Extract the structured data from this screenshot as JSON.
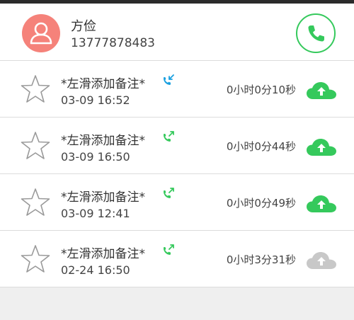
{
  "contact": {
    "name": "方俭",
    "phone": "13777878483",
    "avatar_icon": "person-icon",
    "call_icon": "phone-icon"
  },
  "colors": {
    "avatar_bg": "#f5827a",
    "accent_green": "#35c95c",
    "incoming_blue": "#1aa0e0",
    "cloud_gray": "#c8c8c8"
  },
  "calls": [
    {
      "note": "*左滑添加备注*",
      "date": "03-09 16:52",
      "duration": "0小时0分10秒",
      "direction": "incoming",
      "direction_icon": "incoming-call-icon",
      "uploaded": true,
      "cloud_icon": "cloud-upload-icon"
    },
    {
      "note": "*左滑添加备注*",
      "date": "03-09 16:50",
      "duration": "0小时0分44秒",
      "direction": "outgoing",
      "direction_icon": "outgoing-call-icon",
      "uploaded": true,
      "cloud_icon": "cloud-upload-icon"
    },
    {
      "note": "*左滑添加备注*",
      "date": "03-09 12:41",
      "duration": "0小时0分49秒",
      "direction": "outgoing",
      "direction_icon": "outgoing-call-icon",
      "uploaded": true,
      "cloud_icon": "cloud-upload-icon"
    },
    {
      "note": "*左滑添加备注*",
      "date": "02-24 16:50",
      "duration": "0小时3分31秒",
      "direction": "outgoing",
      "direction_icon": "outgoing-call-icon",
      "uploaded": false,
      "cloud_icon": "cloud-upload-icon"
    }
  ]
}
